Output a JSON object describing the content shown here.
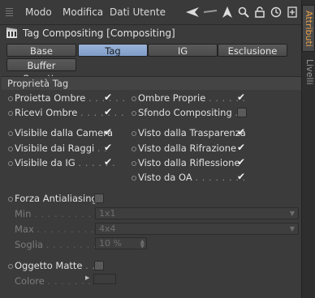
{
  "menu": {
    "modo": "Modo",
    "modifica": "Modifica",
    "dati_utente": "Dati Utente"
  },
  "header": {
    "title": "Tag Compositing [Compositing]"
  },
  "tabs": [
    {
      "label": "Base"
    },
    {
      "label": "Tag"
    },
    {
      "label": "IG"
    },
    {
      "label": "Esclusione"
    },
    {
      "label": "Buffer Oggetto"
    }
  ],
  "section": {
    "title": "Proprietà Tag"
  },
  "left_props": [
    {
      "label": "Proietta Ombre",
      "dots": ". . . . . .",
      "checked": true
    },
    {
      "label": "Ricevi Ombre",
      "dots": ". . . . . . .",
      "checked": true
    },
    {
      "label": "Visibile dalla Camera",
      "dots": "",
      "checked": true
    },
    {
      "label": "Visibile dai Raggi",
      "dots": ". .",
      "checked": true
    },
    {
      "label": "Visibile da IG",
      "dots": ". . . . . .",
      "checked": true
    }
  ],
  "right_props": [
    {
      "label": "Ombre Proprie",
      "dots": ". . . . . .",
      "checked": true
    },
    {
      "label": "Sfondo Compositing",
      "dots": ". .",
      "checked": false
    },
    {
      "label": "Visto dalla Trasparenza",
      "dots": "",
      "checked": true
    },
    {
      "label": "Visto dalla Rifrazione",
      "dots": "",
      "checked": true
    },
    {
      "label": "Visto dalla Riflessione",
      "dots": "",
      "checked": true
    },
    {
      "label": "Visto da OA",
      "dots": ". . . . . . . .",
      "checked": true
    }
  ],
  "antialiasing": {
    "label": "Forza Antialiasing",
    "checked": false,
    "min": {
      "label": "Min",
      "dots": ". . . . . . . . . . . . . . .",
      "value": "1x1"
    },
    "max": {
      "label": "Max",
      "dots": ". . . . . . . . . . . . . . .",
      "value": "4x4"
    },
    "soglia": {
      "label": "Soglia",
      "dots": ". . . . . . . . . . . .",
      "value": "10 %"
    }
  },
  "matte": {
    "label": "Oggetto Matte",
    "dots": ". .",
    "checked": false,
    "color_label": "Colore",
    "color_dots": ". . . . . . . .",
    "color_value": "#3d3d3d"
  },
  "sidebar": {
    "attributi": "Attributi",
    "livelli": "Livelli"
  },
  "colors": {
    "active_tab": "#8fa9d1",
    "accent": "#e8a04a",
    "panel": "#3b3b3b"
  }
}
